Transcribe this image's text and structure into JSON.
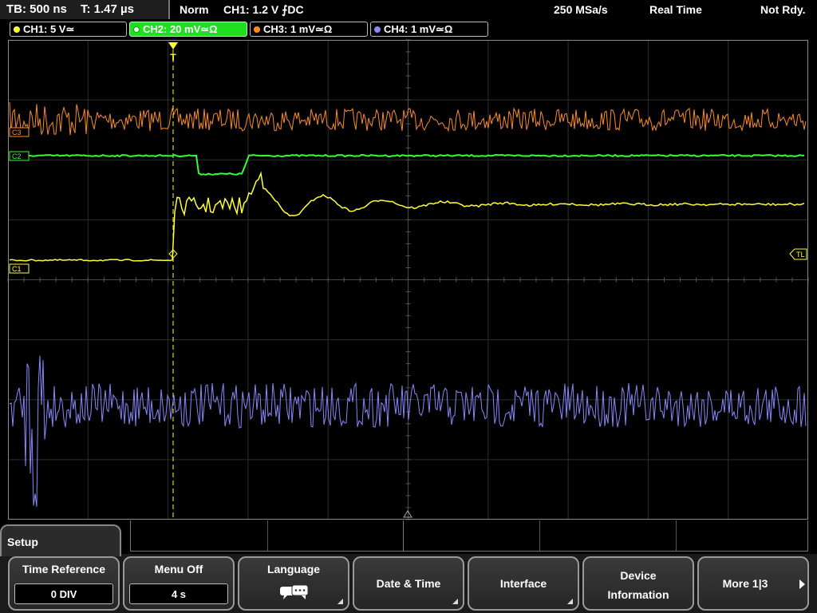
{
  "topbar": {
    "timebase": "TB: 500 ns",
    "trigger_time": "T: 1.47 µs",
    "trigger_mode": "Norm",
    "trigger_source": "CH1: 1.2 V ⨍DC",
    "sample_rate": "250 MSa/s",
    "acq_mode": "Real Time",
    "status": "Not Rdy."
  },
  "channels": [
    {
      "label": "CH1: 5 V≃",
      "color": "#ffff33",
      "active": false
    },
    {
      "label": "CH2: 20 mV≃Ω",
      "color": "#33ff33",
      "active": true
    },
    {
      "label": "CH3: 1 mV≃Ω",
      "color": "#ff8c1a",
      "active": false
    },
    {
      "label": "CH4: 1 mV≃Ω",
      "color": "#8888ff",
      "active": false
    }
  ],
  "markers": {
    "ch1": "C1",
    "ch2": "C2",
    "ch3": "C3",
    "trigger_level": "TL",
    "trigger_pos": "T"
  },
  "menu": {
    "title": "Setup",
    "buttons": [
      {
        "label": "Time Reference",
        "value": "0 DIV"
      },
      {
        "label": "Menu Off",
        "value": "4 s"
      },
      {
        "label": "Language",
        "icon": "speech-bubbles-icon"
      },
      {
        "label": "Date & Time"
      },
      {
        "label": "Interface"
      },
      {
        "label": "Device",
        "label2": "Information"
      },
      {
        "label": "More 1|3",
        "icon": "arrow-right-icon"
      }
    ]
  }
}
